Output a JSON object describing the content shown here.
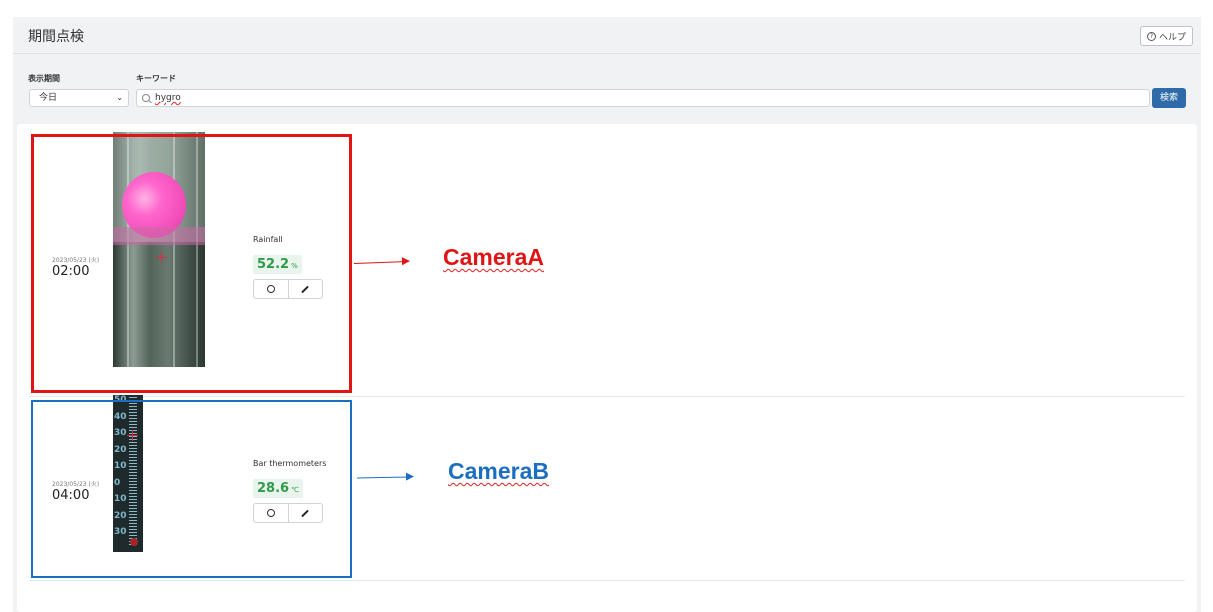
{
  "header": {
    "title": "期間点検",
    "help_label": "ヘルプ"
  },
  "filters": {
    "period_label": "表示期間",
    "period_value": "今日",
    "keyword_label": "キーワード",
    "keyword_value": "hygro",
    "search_label": "検索"
  },
  "records": [
    {
      "date": "2023/05/23 (火)",
      "time": "02:00",
      "name": "Rainfall",
      "value": "52.2",
      "unit": "%"
    },
    {
      "date": "2023/05/23 (火)",
      "time": "04:00",
      "name": "Bar thermometers",
      "value": "28.6",
      "unit": "℃"
    }
  ],
  "thermometer_scale": [
    "50",
    "40",
    "30",
    "20",
    "10",
    "0",
    "10",
    "20",
    "30"
  ],
  "annotations": {
    "camera_a": "CameraA",
    "camera_b": "CameraB",
    "camera_a_color": "#e01414",
    "camera_b_color": "#1c6fbf"
  },
  "icons": {
    "help": "help-circle-icon",
    "search": "search-icon",
    "select": "chevron-down-icon",
    "check": "circle-icon",
    "edit": "pencil-icon"
  }
}
